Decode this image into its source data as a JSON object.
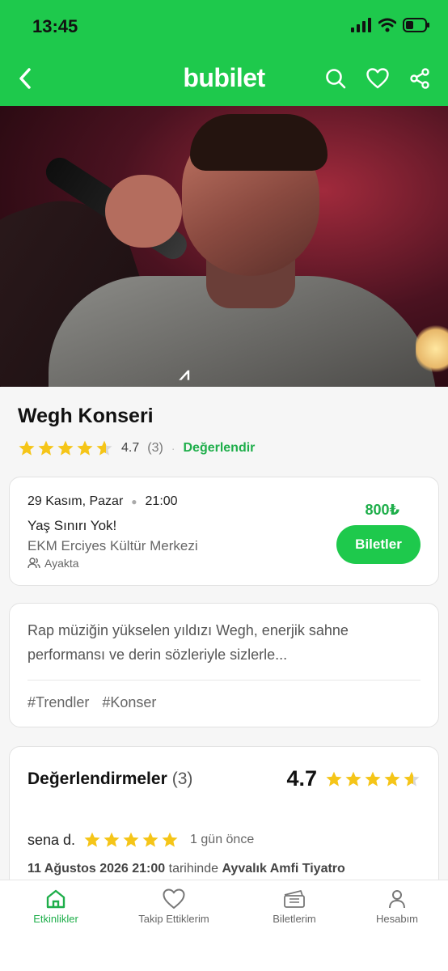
{
  "status_bar": {
    "time": "13:45"
  },
  "header": {
    "brand": "bubilet"
  },
  "hero": {
    "shirt_mark": "UNDER ARMOUR"
  },
  "event": {
    "title": "Wegh Konseri",
    "rating": "4.7",
    "rating_count": "(3)",
    "rating_stars_filled": 4.5,
    "rate_label": "Değerlendir",
    "date": "29 Kasım, Pazar",
    "time": "21:00",
    "age_limit": "Yaş Sınırı Yok!",
    "venue": "EKM Erciyes Kültür Merkezi",
    "seating": "Ayakta",
    "price": "800₺",
    "tickets_button": "Biletler"
  },
  "description": {
    "text": "Rap müziğin yükselen yıldızı Wegh, enerjik sahne performansı ve derin sözleriyle sizlerle...",
    "tags": [
      "#Trendler",
      "#Konser"
    ]
  },
  "reviews": {
    "title": "Değerlendirmeler",
    "count": "(3)",
    "score": "4.7",
    "items": [
      {
        "user": "sena d.",
        "ago": "1 gün önce",
        "event_datetime": "11 Ağustos 2026 21:00",
        "connector": "tarihinde",
        "venue": "Ayvalık Amfi Tiyatro"
      }
    ]
  },
  "tabbar": {
    "items": [
      {
        "label": "Etkinlikler",
        "icon": "home-icon",
        "active": true
      },
      {
        "label": "Takip Ettiklerim",
        "icon": "heart-icon"
      },
      {
        "label": "Biletlerim",
        "icon": "ticket-icon"
      },
      {
        "label": "Hesabım",
        "icon": "user-icon"
      }
    ]
  },
  "colors": {
    "brand_green": "#1ec94c",
    "link_green": "#1eae4a",
    "star_yellow": "#f5c518"
  }
}
